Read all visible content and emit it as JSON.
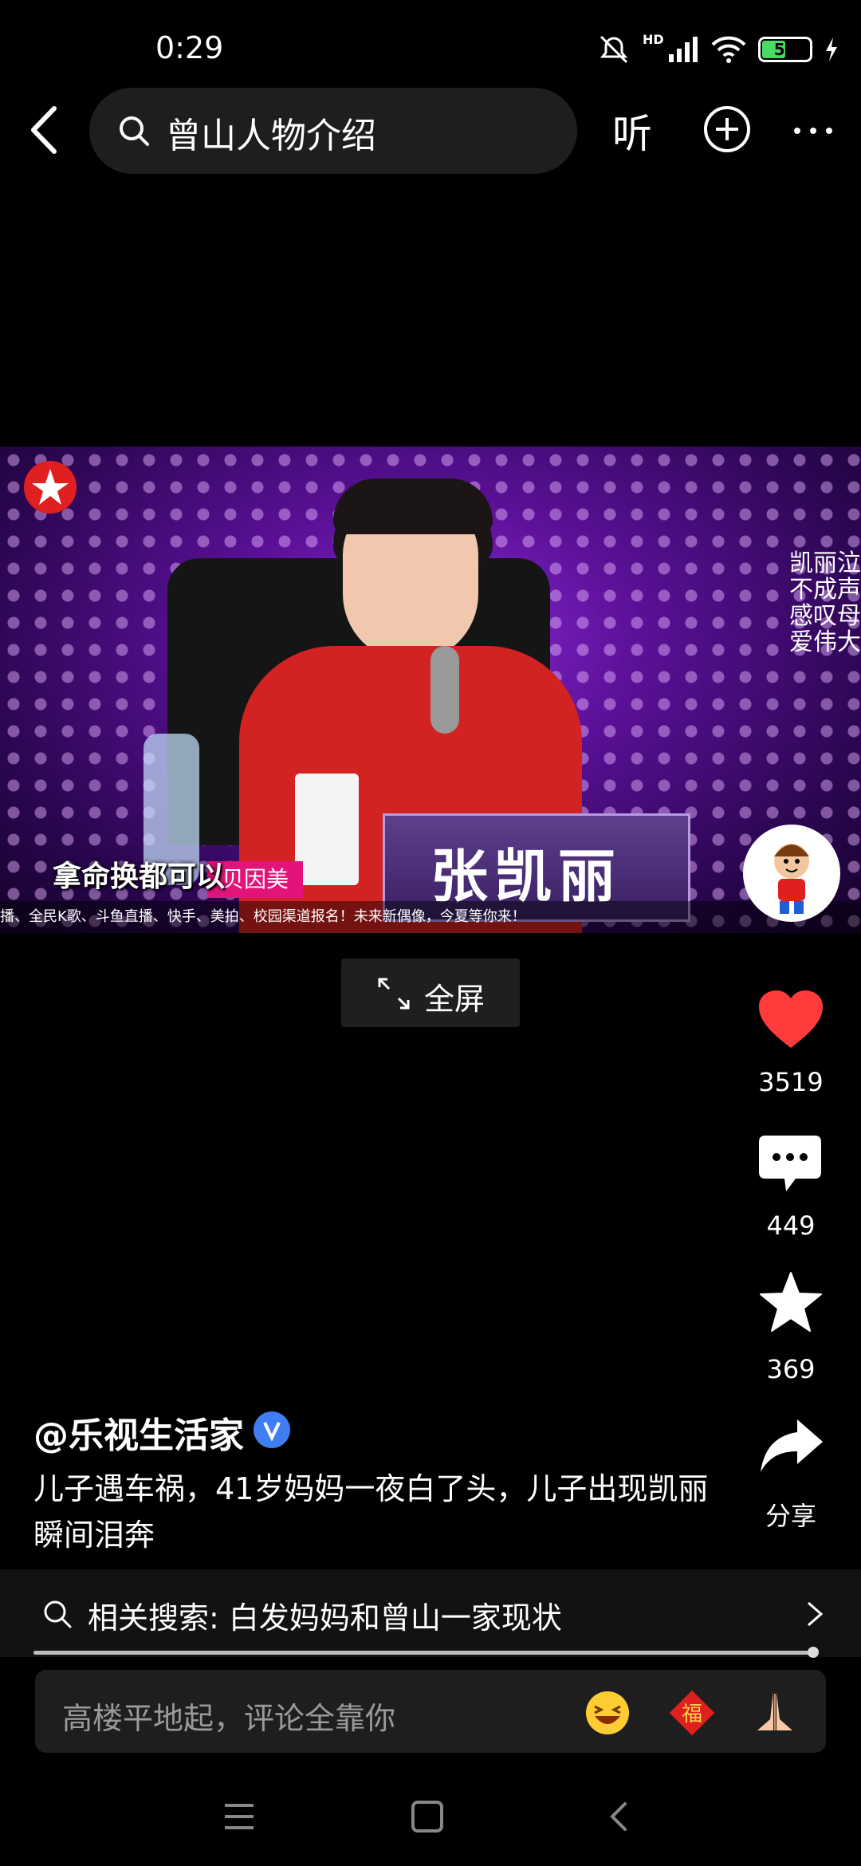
{
  "status_bar": {
    "time": "0:29",
    "network": "HD",
    "battery": "50",
    "battery_level": 0.5,
    "icons": [
      "mute-icon",
      "signal-icon",
      "wifi-icon",
      "battery-icon",
      "charging-icon"
    ]
  },
  "top_bar": {
    "search_query": "曾山人物介绍",
    "listen_label": "听",
    "icons": [
      "back-icon",
      "search-icon",
      "add-icon",
      "more-icon"
    ]
  },
  "video": {
    "nameplate": "张凯丽",
    "caption": "拿命换都可以",
    "side_caption": "凯丽泣不成声 感叹母爱伟大",
    "brand_tag": "贝因美",
    "ticker": "播、全民K歌、斗鱼直播、快手、美拍、校园渠道报名！未来新偶像，今夏等你来！"
  },
  "fullscreen": {
    "label": "全屏"
  },
  "actions": {
    "like_count": "3519",
    "comment_count": "449",
    "favorite_count": "369",
    "share_label": "分享",
    "like_color": "#ff3b3b"
  },
  "post": {
    "author": "@乐视生活家",
    "description": "儿子遇车祸，41岁妈妈一夜白了头，儿子出现凯丽瞬间泪奔"
  },
  "related": {
    "text": "相关搜索: 白发妈妈和曾山一家现状"
  },
  "playback": {
    "progress": 0.998
  },
  "comment": {
    "placeholder": "高楼平地起，评论全靠你",
    "emojis": [
      "laughing-emoji-icon",
      "fu-emoji-icon",
      "pray-emoji-icon"
    ]
  }
}
